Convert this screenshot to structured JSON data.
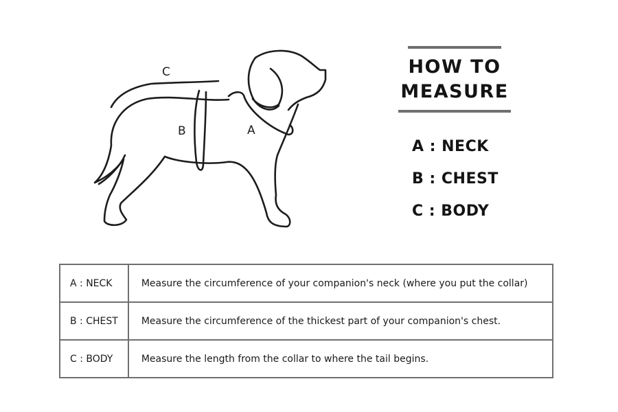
{
  "title": "HOW TO MEASURE",
  "legend": [
    "A : NECK",
    "B : CHEST",
    "C : BODY"
  ],
  "diagram_labels": {
    "a": "A",
    "b": "B",
    "c": "C"
  },
  "table": [
    {
      "code": "A : NECK",
      "description": "Measure the circumference of your companion's neck (where you put the collar)"
    },
    {
      "code": "B : CHEST",
      "description": "Measure the circumference of the thickest part of your companion's chest."
    },
    {
      "code": "C : BODY",
      "description": "Measure the length from the collar to where the tail begins."
    }
  ],
  "colors": {
    "line": "#1c1c1c",
    "rule": "#6f6f6f"
  }
}
